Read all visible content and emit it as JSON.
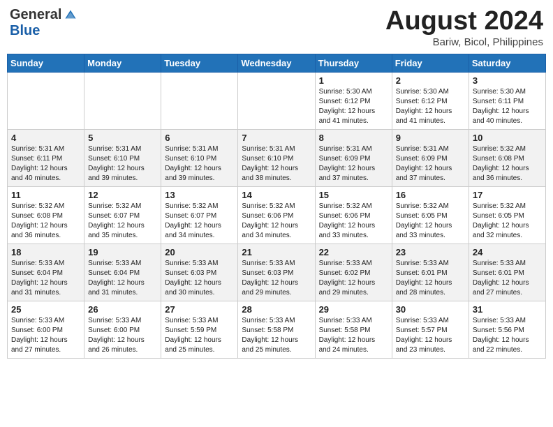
{
  "header": {
    "logo": {
      "general": "General",
      "blue": "Blue"
    },
    "title": "August 2024",
    "location": "Bariw, Bicol, Philippines"
  },
  "days_of_week": [
    "Sunday",
    "Monday",
    "Tuesday",
    "Wednesday",
    "Thursday",
    "Friday",
    "Saturday"
  ],
  "weeks": [
    [
      {
        "day": "",
        "info": ""
      },
      {
        "day": "",
        "info": ""
      },
      {
        "day": "",
        "info": ""
      },
      {
        "day": "",
        "info": ""
      },
      {
        "day": "1",
        "info": "Sunrise: 5:30 AM\nSunset: 6:12 PM\nDaylight: 12 hours\nand 41 minutes."
      },
      {
        "day": "2",
        "info": "Sunrise: 5:30 AM\nSunset: 6:12 PM\nDaylight: 12 hours\nand 41 minutes."
      },
      {
        "day": "3",
        "info": "Sunrise: 5:30 AM\nSunset: 6:11 PM\nDaylight: 12 hours\nand 40 minutes."
      }
    ],
    [
      {
        "day": "4",
        "info": "Sunrise: 5:31 AM\nSunset: 6:11 PM\nDaylight: 12 hours\nand 40 minutes."
      },
      {
        "day": "5",
        "info": "Sunrise: 5:31 AM\nSunset: 6:10 PM\nDaylight: 12 hours\nand 39 minutes."
      },
      {
        "day": "6",
        "info": "Sunrise: 5:31 AM\nSunset: 6:10 PM\nDaylight: 12 hours\nand 39 minutes."
      },
      {
        "day": "7",
        "info": "Sunrise: 5:31 AM\nSunset: 6:10 PM\nDaylight: 12 hours\nand 38 minutes."
      },
      {
        "day": "8",
        "info": "Sunrise: 5:31 AM\nSunset: 6:09 PM\nDaylight: 12 hours\nand 37 minutes."
      },
      {
        "day": "9",
        "info": "Sunrise: 5:31 AM\nSunset: 6:09 PM\nDaylight: 12 hours\nand 37 minutes."
      },
      {
        "day": "10",
        "info": "Sunrise: 5:32 AM\nSunset: 6:08 PM\nDaylight: 12 hours\nand 36 minutes."
      }
    ],
    [
      {
        "day": "11",
        "info": "Sunrise: 5:32 AM\nSunset: 6:08 PM\nDaylight: 12 hours\nand 36 minutes."
      },
      {
        "day": "12",
        "info": "Sunrise: 5:32 AM\nSunset: 6:07 PM\nDaylight: 12 hours\nand 35 minutes."
      },
      {
        "day": "13",
        "info": "Sunrise: 5:32 AM\nSunset: 6:07 PM\nDaylight: 12 hours\nand 34 minutes."
      },
      {
        "day": "14",
        "info": "Sunrise: 5:32 AM\nSunset: 6:06 PM\nDaylight: 12 hours\nand 34 minutes."
      },
      {
        "day": "15",
        "info": "Sunrise: 5:32 AM\nSunset: 6:06 PM\nDaylight: 12 hours\nand 33 minutes."
      },
      {
        "day": "16",
        "info": "Sunrise: 5:32 AM\nSunset: 6:05 PM\nDaylight: 12 hours\nand 33 minutes."
      },
      {
        "day": "17",
        "info": "Sunrise: 5:32 AM\nSunset: 6:05 PM\nDaylight: 12 hours\nand 32 minutes."
      }
    ],
    [
      {
        "day": "18",
        "info": "Sunrise: 5:33 AM\nSunset: 6:04 PM\nDaylight: 12 hours\nand 31 minutes."
      },
      {
        "day": "19",
        "info": "Sunrise: 5:33 AM\nSunset: 6:04 PM\nDaylight: 12 hours\nand 31 minutes."
      },
      {
        "day": "20",
        "info": "Sunrise: 5:33 AM\nSunset: 6:03 PM\nDaylight: 12 hours\nand 30 minutes."
      },
      {
        "day": "21",
        "info": "Sunrise: 5:33 AM\nSunset: 6:03 PM\nDaylight: 12 hours\nand 29 minutes."
      },
      {
        "day": "22",
        "info": "Sunrise: 5:33 AM\nSunset: 6:02 PM\nDaylight: 12 hours\nand 29 minutes."
      },
      {
        "day": "23",
        "info": "Sunrise: 5:33 AM\nSunset: 6:01 PM\nDaylight: 12 hours\nand 28 minutes."
      },
      {
        "day": "24",
        "info": "Sunrise: 5:33 AM\nSunset: 6:01 PM\nDaylight: 12 hours\nand 27 minutes."
      }
    ],
    [
      {
        "day": "25",
        "info": "Sunrise: 5:33 AM\nSunset: 6:00 PM\nDaylight: 12 hours\nand 27 minutes."
      },
      {
        "day": "26",
        "info": "Sunrise: 5:33 AM\nSunset: 6:00 PM\nDaylight: 12 hours\nand 26 minutes."
      },
      {
        "day": "27",
        "info": "Sunrise: 5:33 AM\nSunset: 5:59 PM\nDaylight: 12 hours\nand 25 minutes."
      },
      {
        "day": "28",
        "info": "Sunrise: 5:33 AM\nSunset: 5:58 PM\nDaylight: 12 hours\nand 25 minutes."
      },
      {
        "day": "29",
        "info": "Sunrise: 5:33 AM\nSunset: 5:58 PM\nDaylight: 12 hours\nand 24 minutes."
      },
      {
        "day": "30",
        "info": "Sunrise: 5:33 AM\nSunset: 5:57 PM\nDaylight: 12 hours\nand 23 minutes."
      },
      {
        "day": "31",
        "info": "Sunrise: 5:33 AM\nSunset: 5:56 PM\nDaylight: 12 hours\nand 22 minutes."
      }
    ]
  ]
}
